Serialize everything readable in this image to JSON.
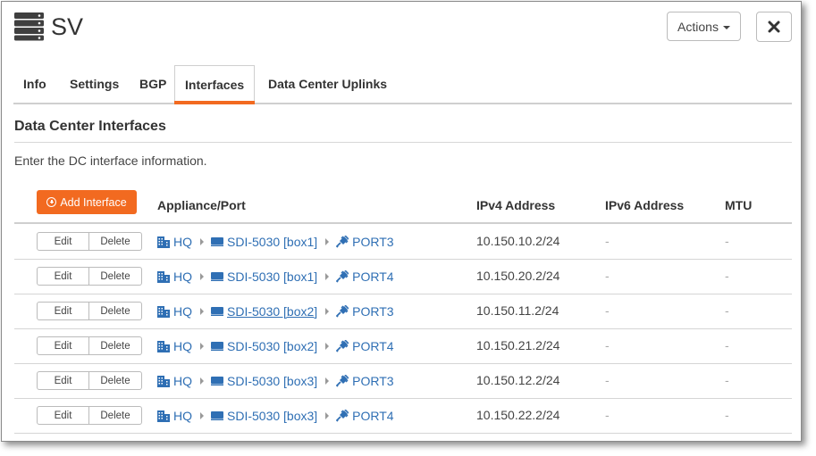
{
  "header": {
    "title": "SV",
    "actions_label": "Actions",
    "icon": "server-stack-icon",
    "close_icon": "close-icon"
  },
  "tabs": [
    {
      "label": "Info",
      "active": false
    },
    {
      "label": "Settings",
      "active": false
    },
    {
      "label": "BGP",
      "active": false
    },
    {
      "label": "Interfaces",
      "active": true
    },
    {
      "label": "Data Center Uplinks",
      "active": false
    }
  ],
  "section": {
    "title": "Data Center Interfaces",
    "description": "Enter the DC interface information."
  },
  "table": {
    "add_button_label": "Add Interface",
    "columns": [
      "Appliance/Port",
      "IPv4 Address",
      "IPv6 Address",
      "MTU"
    ],
    "edit_label": "Edit",
    "delete_label": "Delete",
    "rows": [
      {
        "site": "HQ",
        "appliance": "SDI-5030 [box1]",
        "port": "PORT3",
        "ipv4": "10.150.10.2/24",
        "ipv6": "-",
        "mtu": "-"
      },
      {
        "site": "HQ",
        "appliance": "SDI-5030 [box1]",
        "port": "PORT4",
        "ipv4": "10.150.20.2/24",
        "ipv6": "-",
        "mtu": "-"
      },
      {
        "site": "HQ",
        "appliance": "SDI-5030 [box2]",
        "port": "PORT3",
        "ipv4": "10.150.11.2/24",
        "ipv6": "-",
        "mtu": "-"
      },
      {
        "site": "HQ",
        "appliance": "SDI-5030 [box2]",
        "port": "PORT4",
        "ipv4": "10.150.21.2/24",
        "ipv6": "-",
        "mtu": "-"
      },
      {
        "site": "HQ",
        "appliance": "SDI-5030 [box3]",
        "port": "PORT3",
        "ipv4": "10.150.12.2/24",
        "ipv6": "-",
        "mtu": "-"
      },
      {
        "site": "HQ",
        "appliance": "SDI-5030 [box3]",
        "port": "PORT4",
        "ipv4": "10.150.22.2/24",
        "ipv6": "-",
        "mtu": "-"
      }
    ]
  },
  "colors": {
    "accent": "#f26a20",
    "link": "#2f6fb4"
  }
}
